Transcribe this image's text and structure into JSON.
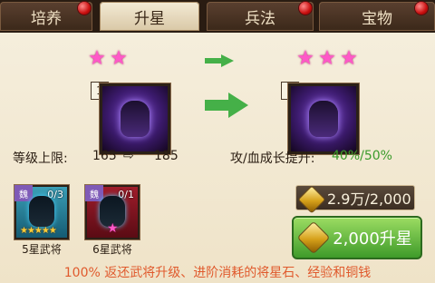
{
  "tabs": [
    {
      "label": "培养"
    },
    {
      "label": "升星"
    },
    {
      "label": "兵法"
    },
    {
      "label": "宝物"
    }
  ],
  "upgrade": {
    "current_tag": "1",
    "next_tag": "2",
    "level_cap_label": "等级上限:",
    "level_from": "165",
    "level_to": "185",
    "growth_label": "攻/血成长提升:",
    "growth_value": "40%/50%"
  },
  "materials": [
    {
      "count": "0/3",
      "label": "5星武将",
      "badge": "魏"
    },
    {
      "count": "0/1",
      "label": "6星武将",
      "badge": "魏"
    }
  ],
  "resource": {
    "amount": "2.9万/2,000"
  },
  "actions": {
    "star_up_label": "2,000升星"
  },
  "footer": {
    "note": "100% 返还武将升级、进阶消耗的将星石、经验和铜钱"
  },
  "colors": {
    "accent_green": "#45b048",
    "star_pink": "#ff58c8",
    "tab_bar": "#2a1c12",
    "footer_orange": "#e05a2d"
  }
}
